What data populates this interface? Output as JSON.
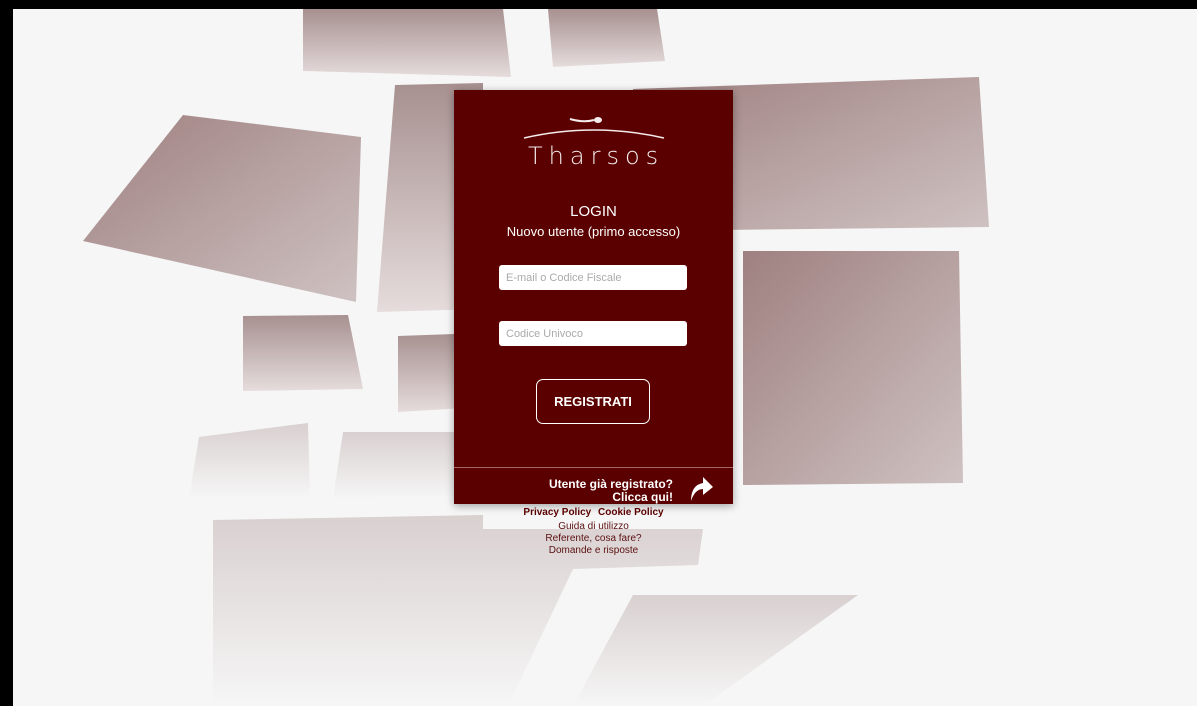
{
  "login": {
    "brand": "Tharsos",
    "title": "LOGIN",
    "subtitle": "Nuovo utente (primo accesso)",
    "email_placeholder": "E-mail o Codice Fiscale",
    "code_placeholder": "Codice Univoco",
    "register_label": "REGISTRATI",
    "already_line1": "Utente già registrato?",
    "already_line2": "Clicca qui!",
    "arrow_icon": "curved-arrow-icon"
  },
  "links": {
    "privacy": "Privacy Policy",
    "cookie": "Cookie Policy",
    "guide": "Guida di utilizzo",
    "referent": "Referente, cosa fare?",
    "faq": "Domande e risposte"
  },
  "colors": {
    "card": "#5b0000",
    "background": "#f6f6f6"
  }
}
